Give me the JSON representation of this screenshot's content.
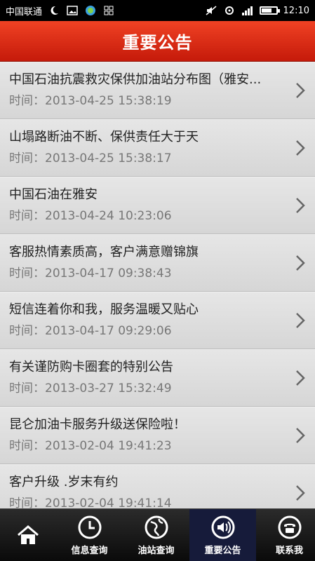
{
  "status_bar": {
    "carrier": "中国联通",
    "time": "12:10",
    "battery_level": 0.65
  },
  "header": {
    "title": "重要公告"
  },
  "notices": [
    {
      "title": "中国石油抗震救灾保供加油站分布图（雅安...",
      "time": "时间：2013-04-25 15:38:19"
    },
    {
      "title": "山塌路断油不断、保供责任大于天",
      "time": "时间：2013-04-25 15:38:17"
    },
    {
      "title": "中国石油在雅安",
      "time": "时间：2013-04-24 10:23:06"
    },
    {
      "title": "客服热情素质高，客户满意赠锦旗",
      "time": "时间：2013-04-17 09:38:43"
    },
    {
      "title": "短信连着你和我，服务温暖又贴心",
      "time": "时间：2013-04-17 09:29:06"
    },
    {
      "title": "有关谨防购卡圈套的特别公告",
      "time": "时间：2013-03-27 15:32:49"
    },
    {
      "title": "昆仑加油卡服务升级送保险啦！",
      "time": "时间：2013-02-04 19:41:23"
    },
    {
      "title": "客户升级 .岁末有约",
      "time": "时间：2013-02-04 19:41:14"
    }
  ],
  "bottom_nav": {
    "info_query": "信息查询",
    "station_query": "油站查询",
    "notices": "重要公告",
    "contact": "联系我"
  },
  "icons": {
    "home": "home-icon",
    "info_query": "clock-icon",
    "station_query": "globe-icon",
    "notices": "speaker-icon",
    "contact": "telephone-icon"
  }
}
